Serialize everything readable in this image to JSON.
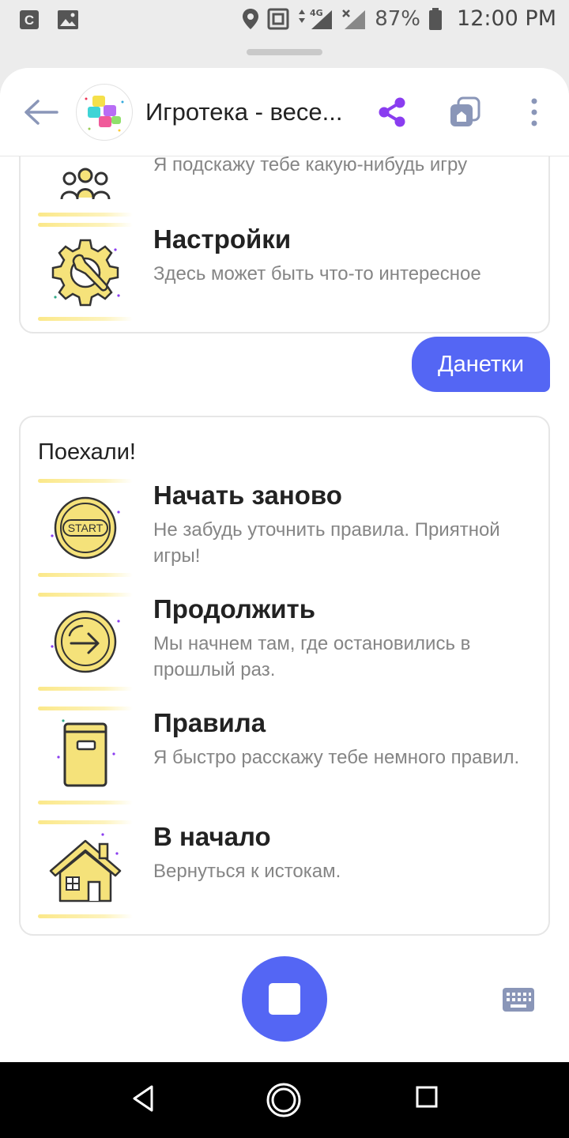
{
  "status_bar": {
    "battery": "87%",
    "time": "12:00 PM",
    "network": "4G"
  },
  "header": {
    "title": "Игротека - весе...",
    "icons": [
      "back-arrow-icon",
      "app-logo",
      "share-icon",
      "devices-icon",
      "more-icon"
    ]
  },
  "previous_card": {
    "items": [
      {
        "title": "",
        "desc": "Я подскажу тебе какую-нибудь игру",
        "icon": "people-icon"
      },
      {
        "title": "Настройки",
        "desc": "Здесь может быть что-то интересное",
        "icon": "gear-wrench-icon"
      }
    ]
  },
  "user_message": "Данетки",
  "reply_card": {
    "heading": "Поехали!",
    "items": [
      {
        "title": "Начать заново",
        "desc": "Не забудь уточнить правила. Приятной игры!",
        "icon": "start-icon",
        "icon_label": "START"
      },
      {
        "title": "Продолжить",
        "desc": "Мы начнем там, где остановились в прошлый раз.",
        "icon": "continue-arrow-icon"
      },
      {
        "title": "Правила",
        "desc": "Я быстро расскажу тебе немного правил.",
        "icon": "book-icon"
      },
      {
        "title": "В начало",
        "desc": "Вернуться к истокам.",
        "icon": "house-icon"
      }
    ]
  },
  "colors": {
    "accent": "#5466f4",
    "icon_yellow": "#f5e27a",
    "share_purple": "#8a3df0"
  }
}
